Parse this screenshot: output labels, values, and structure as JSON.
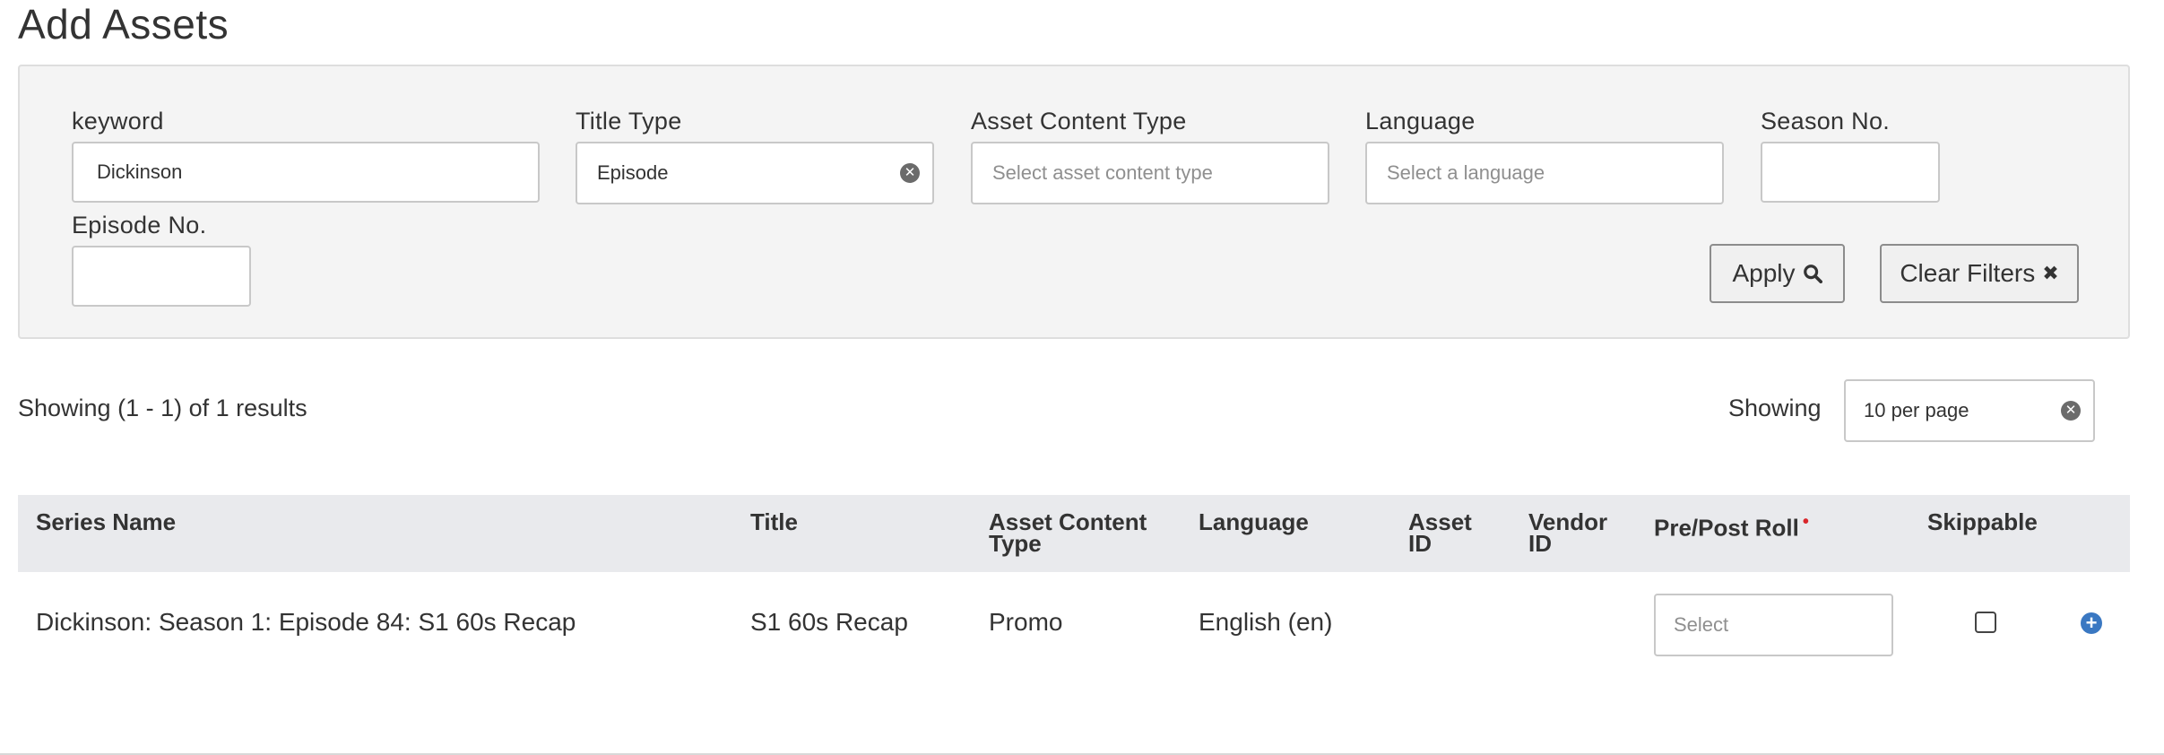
{
  "page": {
    "title": "Add Assets"
  },
  "filters": {
    "keyword": {
      "label": "keyword",
      "value": "Dickinson"
    },
    "title_type": {
      "label": "Title Type",
      "value": "Episode"
    },
    "asset_content_type": {
      "label": "Asset Content Type",
      "placeholder": "Select asset content type"
    },
    "language": {
      "label": "Language",
      "placeholder": "Select a language"
    },
    "season_no": {
      "label": "Season No.",
      "value": ""
    },
    "episode_no": {
      "label": "Episode No.",
      "value": ""
    },
    "apply_label": "Apply",
    "clear_label": "Clear Filters"
  },
  "results": {
    "summary": "Showing (1 - 1) of 1 results",
    "showing_label": "Showing",
    "per_page": "10 per page"
  },
  "table": {
    "headers": {
      "series_name": "Series Name",
      "title": "Title",
      "asset_content_type_1": "Asset Content",
      "asset_content_type_2": "Type",
      "language": "Language",
      "asset_id_1": "Asset",
      "asset_id_2": "ID",
      "vendor_id_1": "Vendor",
      "vendor_id_2": "ID",
      "pre_post_roll": "Pre/Post Roll",
      "required_mark": "•",
      "skippable": "Skippable"
    },
    "rows": [
      {
        "series_name": "Dickinson: Season 1: Episode 84: S1 60s Recap",
        "title": "S1 60s Recap",
        "asset_content_type": "Promo",
        "language": "English (en)",
        "asset_id": "",
        "vendor_id": "",
        "pre_post_roll_placeholder": "Select",
        "skippable": false
      }
    ]
  },
  "icons": {
    "clear": "✕",
    "search": "search-icon",
    "close": "✖",
    "add": "+"
  },
  "colors": {
    "accent": "#3a78c2",
    "required": "#d9262b",
    "panel_bg": "#f4f4f4",
    "header_bg": "#e9eaed"
  }
}
